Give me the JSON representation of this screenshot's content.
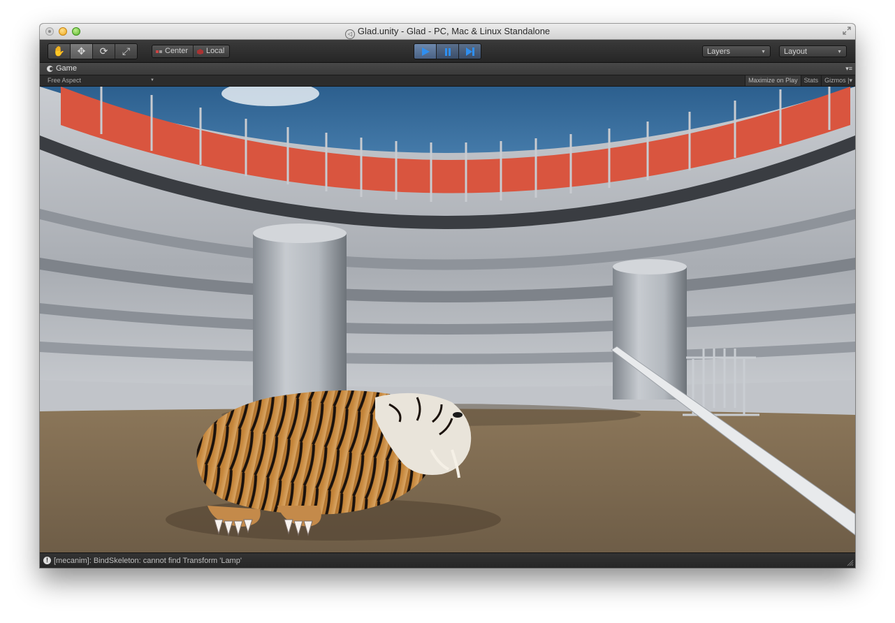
{
  "window": {
    "title": "Glad.unity - Glad - PC, Mac & Linux Standalone"
  },
  "toolbar": {
    "transform_tools": [
      {
        "name": "hand-tool",
        "icon": "hand-icon",
        "glyph": "✋",
        "active": false
      },
      {
        "name": "move-tool",
        "icon": "move-icon",
        "glyph": "✥",
        "active": true
      },
      {
        "name": "rotate-tool",
        "icon": "rotate-icon",
        "glyph": "⟳",
        "active": false
      },
      {
        "name": "scale-tool",
        "icon": "scale-icon",
        "glyph": "⤢",
        "active": false
      }
    ],
    "pivot_label": "Center",
    "space_label": "Local",
    "play_controls": [
      {
        "name": "play-button",
        "icon": "play-icon",
        "active": true
      },
      {
        "name": "pause-button",
        "icon": "pause-icon",
        "active": false
      },
      {
        "name": "step-button",
        "icon": "step-icon",
        "active": false
      }
    ],
    "layers_label": "Layers",
    "layout_label": "Layout"
  },
  "game_view": {
    "tab_label": "Game",
    "aspect_label": "Free Aspect",
    "maximize_label": "Maximize on Play",
    "stats_label": "Stats",
    "gizmos_label": "Gizmos"
  },
  "status": {
    "message": "[mecanim]: BindSkeleton: cannot find Transform 'Lamp'"
  },
  "colors": {
    "accent_play": "#4a6284",
    "sky": "#3b6f9e",
    "banner": "#d9553f",
    "ground": "#7f6e58"
  }
}
